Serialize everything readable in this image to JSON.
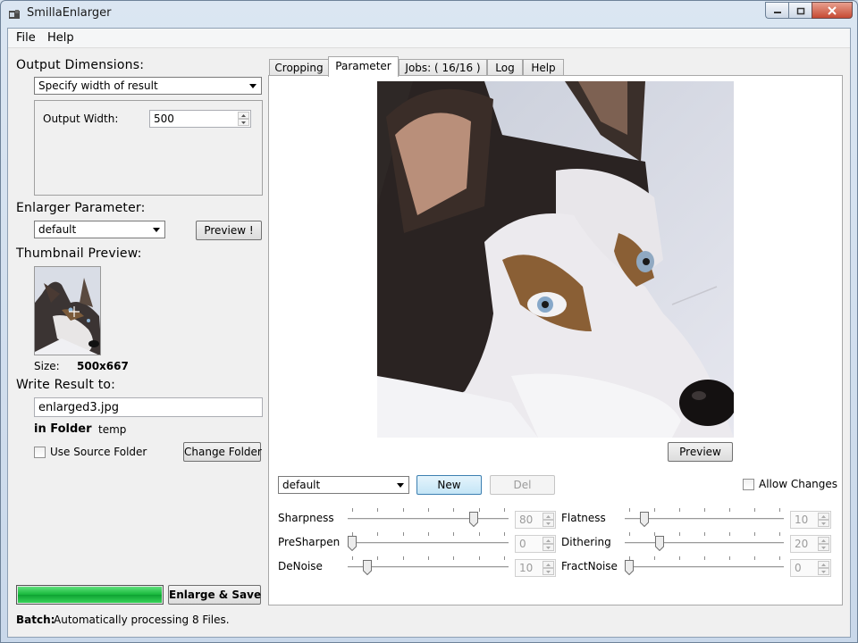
{
  "window": {
    "title": "SmillaEnlarger"
  },
  "menu": {
    "file": "File",
    "help": "Help"
  },
  "left": {
    "output_dimensions_title": "Output Dimensions:",
    "dimension_mode": "Specify width of result",
    "output_width_label": "Output Width:",
    "output_width_value": "500",
    "enlarger_parameter_title": "Enlarger Parameter:",
    "enlarger_preset": "default",
    "preview_button": "Preview !",
    "thumbnail_title": "Thumbnail Preview:",
    "size_label": "Size:",
    "size_value": "500x667",
    "write_result_title": "Write Result to:",
    "filename": "enlarged3.jpg",
    "in_folder_label": "in Folder",
    "folder_value": "temp",
    "use_source_folder": "Use Source Folder",
    "change_folder_button": "Change Folder",
    "progress_fraction": 1.0,
    "enlarge_save_button": "Enlarge & Save",
    "batch_label": "Batch:",
    "batch_text": "Automatically processing 8 Files."
  },
  "tabs": [
    {
      "label": "Cropping",
      "active": false
    },
    {
      "label": "Parameter",
      "active": true
    },
    {
      "label": "Jobs: ( 16/16 )",
      "active": false
    },
    {
      "label": "Log",
      "active": false
    },
    {
      "label": "Help",
      "active": false
    }
  ],
  "parameter": {
    "preview_button": "Preview",
    "preset": "default",
    "new_button": "New",
    "del_button": "Del",
    "allow_changes": "Allow Changes",
    "sliders": [
      {
        "label": "Sharpness",
        "value": "80"
      },
      {
        "label": "Flatness",
        "value": "10"
      },
      {
        "label": "PreSharpen",
        "value": "0"
      },
      {
        "label": "Dithering",
        "value": "20"
      },
      {
        "label": "DeNoise",
        "value": "10"
      },
      {
        "label": "FractNoise",
        "value": "0"
      }
    ]
  }
}
